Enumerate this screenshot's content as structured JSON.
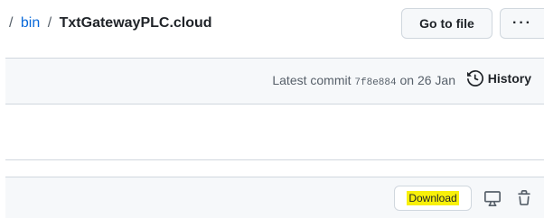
{
  "breadcrumb": {
    "separator": "/",
    "parent": "bin",
    "current": "TxtGatewayPLC.cloud"
  },
  "header": {
    "go_to_file_label": "Go to file",
    "more_label": "···"
  },
  "commit": {
    "prefix": "Latest commit",
    "sha": "7f8e884",
    "date_text": "on 26 Jan",
    "history_label": "History"
  },
  "file_toolbar": {
    "download_label": "Download",
    "highlight_color": "#f8f00a"
  },
  "icons": [
    "history-icon",
    "desktop-icon",
    "trash-icon"
  ]
}
